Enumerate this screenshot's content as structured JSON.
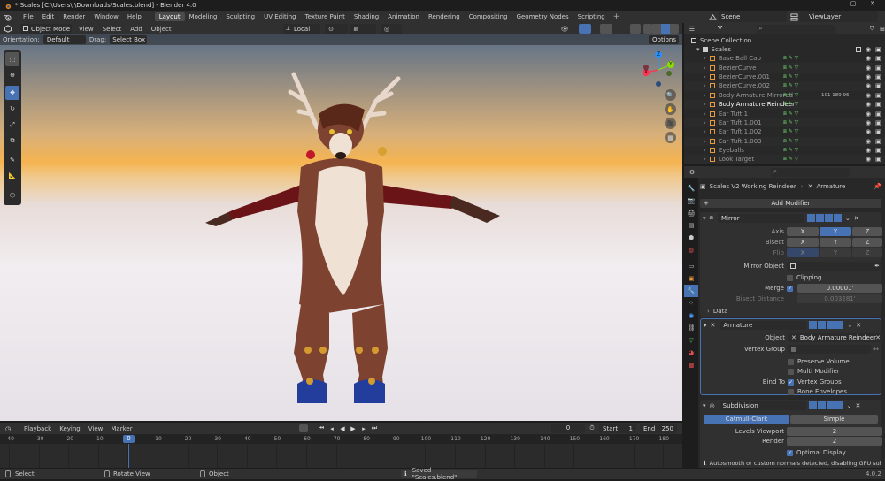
{
  "window": {
    "title": "* Scales [C:\\Users\\        \\Downloads\\Scales.blend] - Blender 4.0"
  },
  "menu": [
    "File",
    "Edit",
    "Render",
    "Window",
    "Help"
  ],
  "workspaces": [
    "Layout",
    "Modeling",
    "Sculpting",
    "UV Editing",
    "Texture Paint",
    "Shading",
    "Animation",
    "Rendering",
    "Compositing",
    "Geometry Nodes",
    "Scripting"
  ],
  "scene": {
    "name": "Scene",
    "view_layer": "ViewLayer"
  },
  "viewport_header": {
    "mode": "Object Mode",
    "view": "View",
    "select": "Select",
    "add": "Add",
    "object": "Object",
    "transform": "Local"
  },
  "viewport_sub": {
    "orientation_label": "Orientation:",
    "orientation": "Default",
    "drag_label": "Drag:",
    "drag": "Select Box",
    "options": "Options"
  },
  "gizmo": {
    "x": "X",
    "y": "Y",
    "z": "Z"
  },
  "outliner": {
    "collection": "Scene Collection",
    "sub": "Scales",
    "items": [
      "Base Ball Cap",
      "BezierCurve",
      "BezierCurve.001",
      "BezierCurve.002",
      "Body Armature Mirrored",
      "Body Armature Reindeer",
      "Ear Tuft 1",
      "Ear Tuft 1.001",
      "Ear Tuft 1.002",
      "Ear Tuft 1.003",
      "Eyeballs",
      "Look Target"
    ],
    "counts": "101 189 96"
  },
  "properties": {
    "object": "Scales V2 Working Reindeer",
    "armature": "Armature",
    "add_modifier": "Add Modifier",
    "mirror": {
      "name": "Mirror",
      "axis": "Axis",
      "bisect": "Bisect",
      "flip": "Flip",
      "x": "X",
      "y": "Y",
      "z": "Z",
      "mirror_object": "Mirror Object",
      "clipping": "Clipping",
      "merge": "Merge",
      "merge_value": "0.00001'",
      "bisect_distance": "Bisect Distance",
      "bisect_value": "0.003281'",
      "data": "Data"
    },
    "armature_mod": {
      "name": "Armature",
      "object_label": "Object",
      "object_value": "Body Armature Reindeer",
      "vertex_group": "Vertex Group",
      "preserve_volume": "Preserve Volume",
      "multi_modifier": "Multi Modifier",
      "bind_to": "Bind To",
      "vertex_groups": "Vertex Groups",
      "bone_envelopes": "Bone Envelopes"
    },
    "subdivision": {
      "name": "Subdivision",
      "catmull": "Catmull-Clark",
      "simple": "Simple",
      "levels_viewport": "Levels Viewport",
      "levels_viewport_value": "2",
      "render": "Render",
      "render_value": "2",
      "optimal_display": "Optimal Display",
      "warning": "Autosmooth or custom normals detected, disabling GPU subdivisi..."
    }
  },
  "timeline": {
    "playback": "Playback",
    "keying": "Keying",
    "view": "View",
    "marker": "Marker",
    "current": "0",
    "start_label": "Start",
    "start": "1",
    "end_label": "End",
    "end": "250",
    "ticks": [
      "-40",
      "-30",
      "-20",
      "-10",
      "0",
      "10",
      "20",
      "30",
      "40",
      "50",
      "60",
      "70",
      "80",
      "90",
      "100",
      "110",
      "120",
      "130",
      "140",
      "150",
      "160",
      "170",
      "180"
    ],
    "current_frame": "0"
  },
  "status": {
    "select": "Select",
    "rotate": "Rotate View",
    "object": "Object",
    "saved": "Saved \"Scales.blend\"",
    "version": "4.0.2"
  },
  "colors": {
    "accent": "#4772b3",
    "gizmo_x": "#ff3352",
    "gizmo_y": "#8bdc00",
    "gizmo_z": "#2890ff"
  }
}
